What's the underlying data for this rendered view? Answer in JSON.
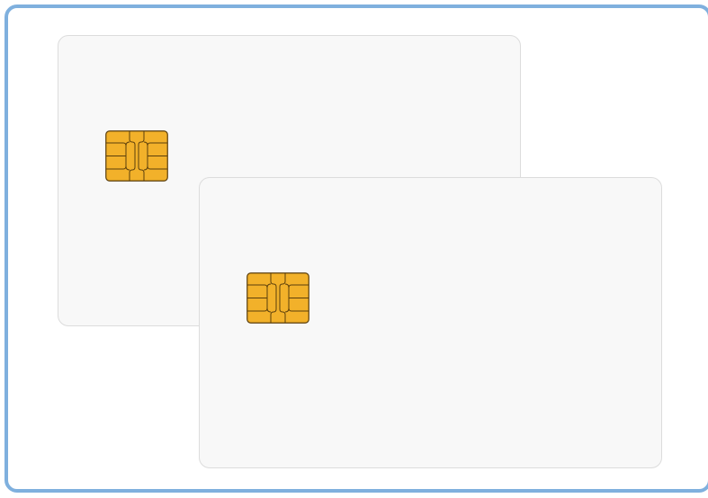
{
  "scene": {
    "subject": "two-smart-cards",
    "colors": {
      "frame_border": "#7fb0de",
      "card_fill": "#f8f8f8",
      "card_border": "#dcdcdc",
      "chip_fill": "#f2b12a",
      "chip_outline": "#5a3e0c"
    },
    "cards": [
      {
        "id": "back",
        "chip_icon": "smart-card-chip-icon"
      },
      {
        "id": "front",
        "chip_icon": "smart-card-chip-icon"
      }
    ]
  }
}
